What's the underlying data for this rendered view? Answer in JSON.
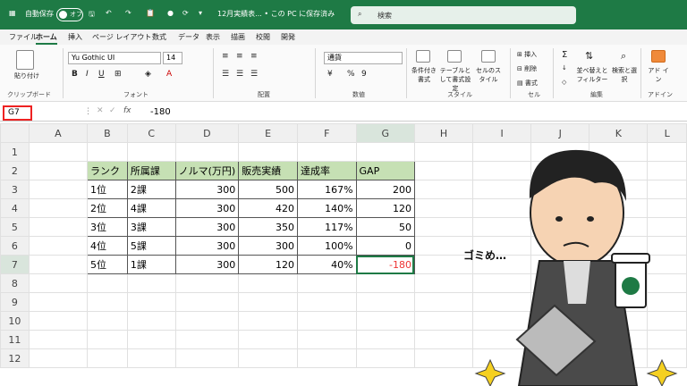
{
  "titlebar": {
    "autosave": "自動保存",
    "toggle": "オフ",
    "filename": "12月実績表... • この PC に保存済み",
    "search_placeholder": "検索"
  },
  "menu": [
    "ファイル",
    "ホーム",
    "挿入",
    "ページ レイアウト",
    "数式",
    "データ",
    "表示",
    "描画",
    "校閲",
    "開発"
  ],
  "ribbon": {
    "paste": "貼り付け",
    "clipboard": "クリップボード",
    "font_name": "Yu Gothic UI",
    "font_size": "14",
    "font_group": "フォント",
    "align_group": "配置",
    "number_format": "通貨",
    "number_group": "数値",
    "cond_format": "条件付き書式",
    "table_format": "テーブルとして書式設定",
    "cell_style": "セルのスタイル",
    "style_group": "スタイル",
    "insert": "挿入",
    "delete": "削除",
    "format": "書式",
    "cell_group": "セル",
    "sort_filter": "並べ替えとフィルター",
    "find_select": "検索と選択",
    "edit_group": "編集",
    "addins": "アド イン",
    "addins_group": "アドイン"
  },
  "formula_bar": {
    "name_box": "G7",
    "fx": "fx",
    "value": "-180"
  },
  "columns": [
    "A",
    "B",
    "C",
    "D",
    "E",
    "F",
    "G",
    "H",
    "I",
    "J",
    "K",
    "L"
  ],
  "rows": [
    "1",
    "2",
    "3",
    "4",
    "5",
    "6",
    "7",
    "8",
    "9",
    "10",
    "11",
    "12"
  ],
  "table": {
    "headers": [
      "ランク",
      "所属課",
      "ノルマ(万円)",
      "販売実績",
      "達成率",
      "GAP"
    ],
    "data": [
      [
        "1位",
        "2課",
        "300",
        "500",
        "167%",
        "200"
      ],
      [
        "2位",
        "4課",
        "300",
        "420",
        "140%",
        "120"
      ],
      [
        "3位",
        "3課",
        "300",
        "350",
        "117%",
        "50"
      ],
      [
        "4位",
        "5課",
        "300",
        "300",
        "100%",
        "0"
      ],
      [
        "5位",
        "1課",
        "300",
        "120",
        "40%",
        "-180"
      ]
    ]
  },
  "speech": "ゴミめ…",
  "colors": {
    "excel_green": "#1e7a45",
    "header_fill": "#c6e0b4",
    "negative": "#e33333",
    "highlight": "#e22222"
  }
}
